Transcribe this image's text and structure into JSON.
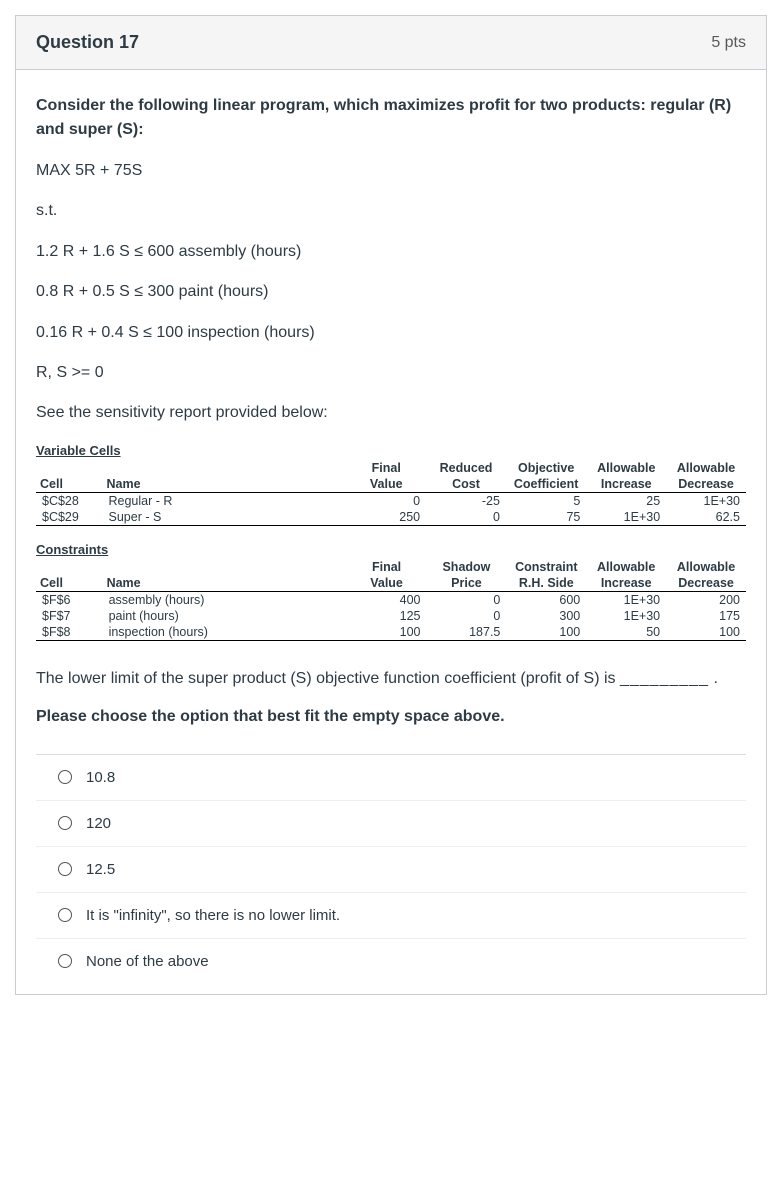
{
  "header": {
    "title": "Question 17",
    "points": "5 pts"
  },
  "body": {
    "intro": "Consider the following linear program, which maximizes profit for two products: regular (R) and super (S):",
    "objective": "MAX 5R + 75S",
    "subject_to": "s.t.",
    "c1": "1.2 R + 1.6 S ≤ 600  assembly (hours)",
    "c2": "0.8 R + 0.5 S ≤ 300    paint (hours)",
    "c3": "0.16 R + 0.4 S ≤ 100    inspection (hours)",
    "nonneg": "R, S  >= 0",
    "see_report": "See the sensitivity report provided below:"
  },
  "var_cells": {
    "label": "Variable Cells",
    "h1": {
      "c": "",
      "n": "",
      "fv": "Final",
      "rc": "Reduced",
      "oc": "Objective",
      "ai": "Allowable",
      "ad": "Allowable"
    },
    "h2": {
      "c": "Cell",
      "n": "Name",
      "fv": "Value",
      "rc": "Cost",
      "oc": "Coefficient",
      "ai": "Increase",
      "ad": "Decrease"
    },
    "rows": [
      {
        "cell": "$C$28",
        "name": "Regular - R",
        "fv": "0",
        "rc": "-25",
        "oc": "5",
        "ai": "25",
        "ad": "1E+30"
      },
      {
        "cell": "$C$29",
        "name": "Super - S",
        "fv": "250",
        "rc": "0",
        "oc": "75",
        "ai": "1E+30",
        "ad": "62.5"
      }
    ]
  },
  "constraints": {
    "label": "Constraints",
    "h1": {
      "c": "",
      "n": "",
      "fv": "Final",
      "sp": "Shadow",
      "rh": "Constraint",
      "ai": "Allowable",
      "ad": "Allowable"
    },
    "h2": {
      "c": "Cell",
      "n": "Name",
      "fv": "Value",
      "sp": "Price",
      "rh": "R.H. Side",
      "ai": "Increase",
      "ad": "Decrease"
    },
    "rows": [
      {
        "cell": "$F$6",
        "name": "assembly (hours)",
        "fv": "400",
        "sp": "0",
        "rh": "600",
        "ai": "1E+30",
        "ad": "200"
      },
      {
        "cell": "$F$7",
        "name": "paint (hours)",
        "fv": "125",
        "sp": "0",
        "rh": "300",
        "ai": "1E+30",
        "ad": "175"
      },
      {
        "cell": "$F$8",
        "name": "inspection (hours)",
        "fv": "100",
        "sp": "187.5",
        "rh": "100",
        "ai": "50",
        "ad": "100"
      }
    ]
  },
  "question": {
    "text_before": "The lower limit of the super product (S) objective function coefficient (profit of S) is ",
    "blank": "_________",
    "text_after": " .",
    "instruct": "Please choose the option that best fit the empty space above."
  },
  "options": [
    "10.8",
    "120",
    "12.5",
    "It is \"infinity\", so there is no lower limit.",
    "None of the above"
  ]
}
